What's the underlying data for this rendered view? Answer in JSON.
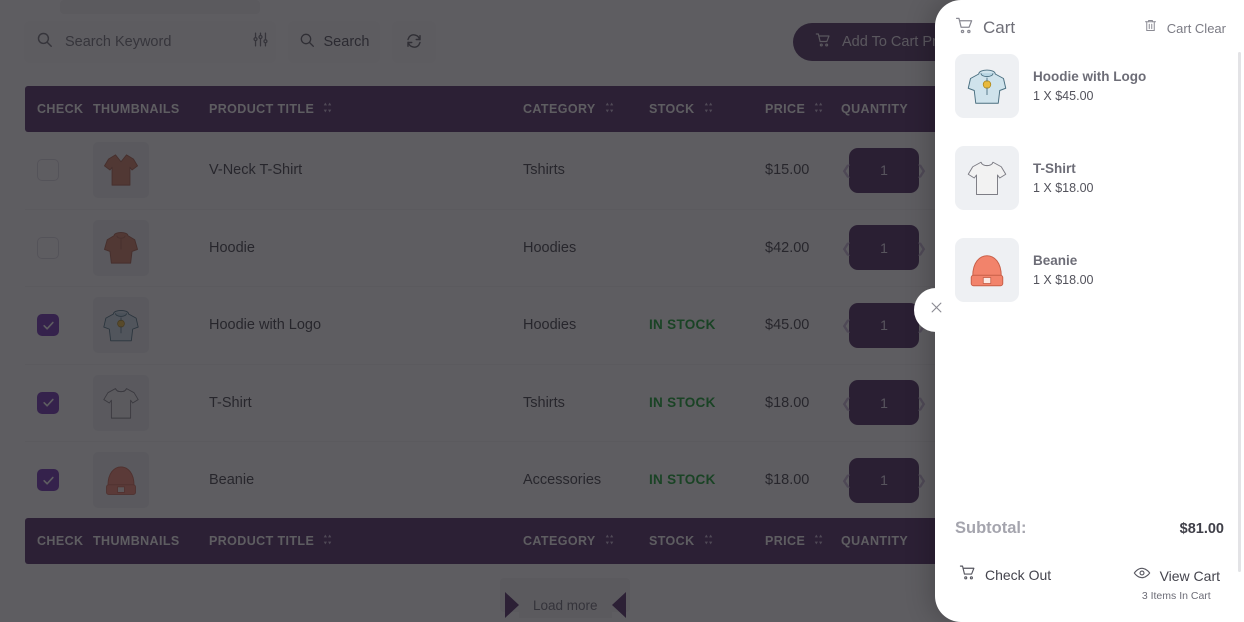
{
  "toolbar": {
    "search_placeholder": "Search Keyword",
    "search_value": "",
    "search_button": "Search",
    "search_icon": "search-icon",
    "filter_icon": "sliders-icon",
    "refresh_icon": "refresh-icon",
    "add_to_cart_button": "Add To Cart Product",
    "add_to_cart_icon": "cart-icon"
  },
  "table": {
    "columns": [
      {
        "key": "check",
        "label": "CHECK",
        "sortable": false
      },
      {
        "key": "thumb",
        "label": "THUMBNAILS",
        "sortable": false
      },
      {
        "key": "title",
        "label": "PRODUCT TITLE",
        "sortable": true
      },
      {
        "key": "cat",
        "label": "CATEGORY",
        "sortable": true
      },
      {
        "key": "stock",
        "label": "STOCK",
        "sortable": true
      },
      {
        "key": "price",
        "label": "PRICE",
        "sortable": true
      },
      {
        "key": "qty",
        "label": "QUANTITY",
        "sortable": false
      }
    ],
    "rows": [
      {
        "checked": false,
        "icon": "tshirt-vneck-icon",
        "title": "V-Neck T-Shirt",
        "category": "Tshirts",
        "stock": "",
        "price": "$15.00",
        "quantity": "1"
      },
      {
        "checked": false,
        "icon": "hoodie-icon",
        "title": "Hoodie",
        "category": "Hoodies",
        "stock": "",
        "price": "$42.00",
        "quantity": "1"
      },
      {
        "checked": true,
        "icon": "hoodie-logo-icon",
        "title": "Hoodie with Logo",
        "category": "Hoodies",
        "stock": "IN STOCK",
        "price": "$45.00",
        "quantity": "1"
      },
      {
        "checked": true,
        "icon": "tshirt-icon",
        "title": "T-Shirt",
        "category": "Tshirts",
        "stock": "IN STOCK",
        "price": "$18.00",
        "quantity": "1"
      },
      {
        "checked": true,
        "icon": "beanie-icon",
        "title": "Beanie",
        "category": "Accessories",
        "stock": "IN STOCK",
        "price": "$18.00",
        "quantity": "1"
      }
    ],
    "load_more": "Load more"
  },
  "cart": {
    "title": "Cart",
    "title_icon": "cart-icon",
    "clear_label": "Cart Clear",
    "clear_icon": "trash-icon",
    "close_icon": "close-icon",
    "items": [
      {
        "icon": "hoodie-logo-icon",
        "name": "Hoodie with Logo",
        "qty_price": "1 X $45.00"
      },
      {
        "icon": "tshirt-icon",
        "name": "T-Shirt",
        "qty_price": "1 X $18.00"
      },
      {
        "icon": "beanie-icon",
        "name": "Beanie",
        "qty_price": "1 X $18.00"
      }
    ],
    "subtotal_label": "Subtotal:",
    "subtotal_value": "$81.00",
    "checkout_label": "Check Out",
    "checkout_icon": "cart-icon",
    "view_cart_label": "View Cart",
    "view_cart_icon": "eye-icon",
    "items_in_cart": "3 Items In Cart"
  },
  "colors": {
    "brand_purple": "#4b2461",
    "checkbox_purple": "#6c2bb3",
    "qty_purple": "#45215b",
    "in_stock_green": "#0ba228",
    "scrim": "rgba(32,30,36,0.72)"
  }
}
